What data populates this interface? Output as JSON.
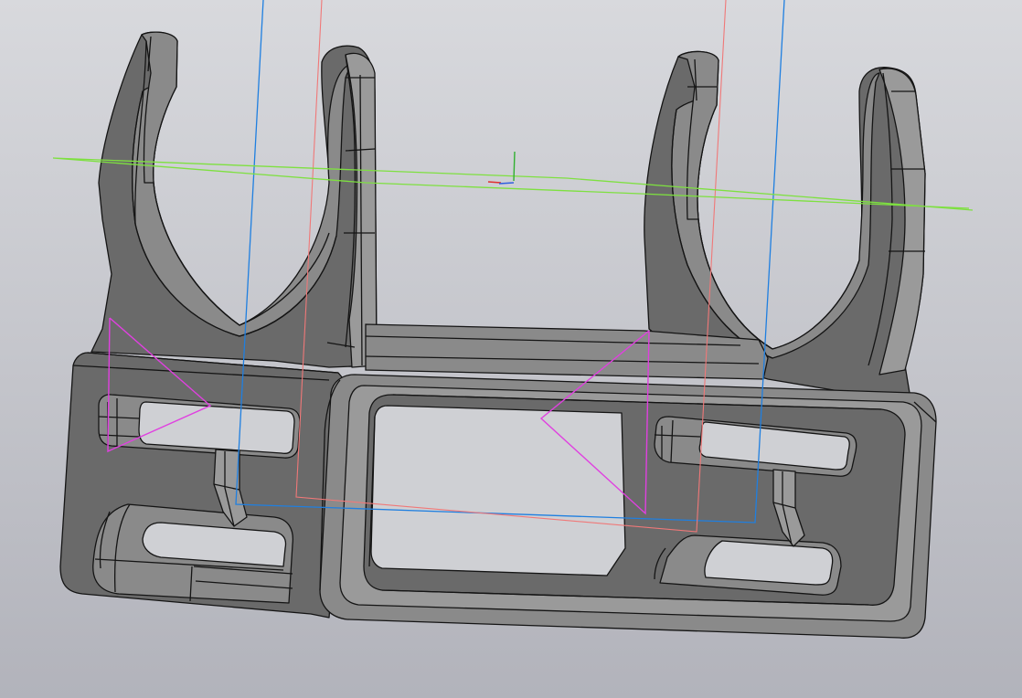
{
  "viewport": {
    "background_top": "#d8d9dd",
    "background_bottom": "#b2b3bb"
  },
  "model": {
    "fill_side": "#6a6a6a",
    "fill_face": "#8a8a8a",
    "fill_light": "#9a9a9a",
    "edge": "#141414"
  },
  "overlays": {
    "blue_plane": "#1f7fe0",
    "red_plane": "#f07878",
    "green_plane": "#7ee040",
    "sketch": "#e040e0",
    "triad_x": "#e03030",
    "triad_y": "#30b030",
    "triad_z": "#3060e0"
  }
}
